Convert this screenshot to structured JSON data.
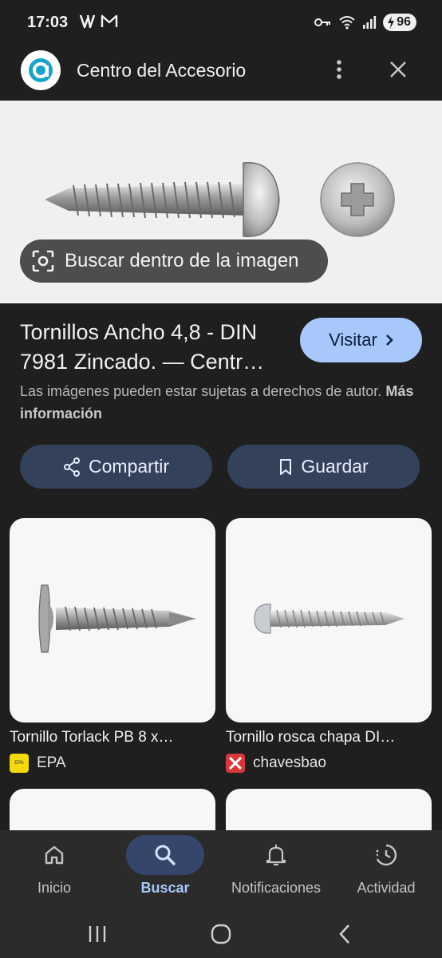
{
  "status_bar": {
    "time": "17:03",
    "battery": "96"
  },
  "app_bar": {
    "title": "Centro del Accesorio"
  },
  "hero": {
    "lens_label": "Buscar dentro de la imagen"
  },
  "result": {
    "title": "Tornillos Ancho 4,8 - DIN 7981 Zincado. — Centr…",
    "visit_label": "Visitar",
    "copyright_text": "Las imágenes pueden estar sujetas a derechos de autor.",
    "more_info": "Más información",
    "share_label": "Compartir",
    "save_label": "Guardar"
  },
  "related": [
    {
      "title": "Tornillo Torlack PB 8 x…",
      "source": "EPA",
      "source_color": "#f5d90a"
    },
    {
      "title": "Tornillo rosca chapa DI…",
      "source": "chavesbao",
      "source_color": "#d8383a"
    }
  ],
  "bottom_nav": [
    {
      "label": "Inicio",
      "icon": "home-icon",
      "active": false
    },
    {
      "label": "Buscar",
      "icon": "search-icon",
      "active": true
    },
    {
      "label": "Notificaciones",
      "icon": "bell-icon",
      "active": false
    },
    {
      "label": "Actividad",
      "icon": "activity-icon",
      "active": false
    }
  ],
  "colors": {
    "accent": "#a8c7fa",
    "background": "#1f1f1f",
    "tonal_button": "#33415a"
  }
}
